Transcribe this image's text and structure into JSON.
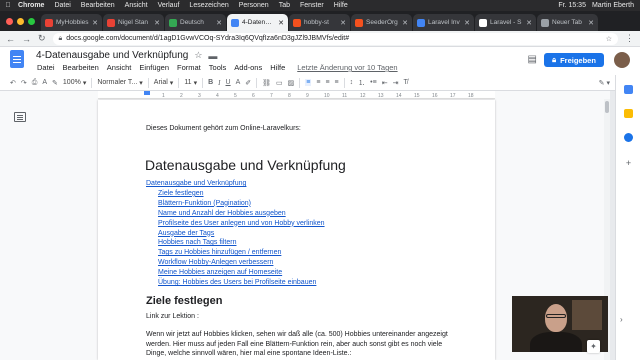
{
  "mac_menu": {
    "app": "Chrome",
    "items": [
      "Datei",
      "Bearbeiten",
      "Ansicht",
      "Verlauf",
      "Lesezeichen",
      "Personen",
      "Tab",
      "Fenster",
      "Hilfe"
    ],
    "right": [
      "Fr. 15:35",
      "Martin Eberth"
    ]
  },
  "tabs": [
    {
      "label": "MyHobbies",
      "color": "#e94235"
    },
    {
      "label": "Nigel Stan",
      "color": "#e94235"
    },
    {
      "label": "Deutsch",
      "color": "#34a853"
    },
    {
      "label": "4-Datenaus",
      "color": "#4285f4"
    },
    {
      "label": "hobby-st",
      "color": "#f4511e"
    },
    {
      "label": "SeederOrg",
      "color": "#f4511e"
    },
    {
      "label": "Laravel Inv",
      "color": "#4285f4"
    },
    {
      "label": "Laravel - S",
      "color": "#ffffff"
    },
    {
      "label": "Neuer Tab",
      "color": "#9aa0a6"
    }
  ],
  "address": {
    "url": "docs.google.com/document/d/1agD1GvwVCOq-SYdra3Iq6QVqfIza6nD3gJZl9JBMVfs/edit#"
  },
  "doc": {
    "title": "4-Datenausgabe und Verknüpfung",
    "menu": [
      "Datei",
      "Bearbeiten",
      "Ansicht",
      "Einfügen",
      "Format",
      "Tools",
      "Add-ons",
      "Hilfe"
    ],
    "last_edit": "Letzte Änderung vor 10 Tagen",
    "share_label": "Freigeben"
  },
  "toolbar": {
    "zoom": "100%",
    "style": "Normaler T...",
    "font": "Arial",
    "size": "11"
  },
  "ruler": [
    "1",
    "2",
    "3",
    "4",
    "5",
    "6",
    "7",
    "8",
    "9",
    "10",
    "11",
    "12",
    "13",
    "14",
    "15",
    "16",
    "17",
    "18"
  ],
  "content": {
    "intro": "Dieses Dokument gehört zum Online-Laravelkurs:",
    "heading": "Datenausgabe und Verknüpfung",
    "toc": [
      "Datenausgabe und Verknüpfung",
      "Ziele festlegen",
      "Blättern-Funktion (Pagination)",
      "Name und Anzahl der Hobbies ausgeben",
      "Profilseite des User anlegen und von Hobby verlinken",
      "Ausgabe der Tags",
      "Hobbies nach Tags filtern",
      "Tags zu Hobbies hinzufügen / entfernen",
      "Workflow Hobby-Anlegen verbessern",
      "Meine Hobbies anzeigen auf Homeseite",
      "Übung: Hobbies des Users bei Profilseite einbauen"
    ],
    "section_heading": "Ziele festlegen",
    "link_text": "Link zur Lektion :",
    "paragraph": "Wenn wir jetzt auf Hobbies klicken, sehen wir daß alle (ca. 500) Hobbies untereinander angezeigt werden. Hier muss auf jeden Fall eine Blättern-Funktion rein, aber auch sonst gibt es noch viele Dinge, welche sinnvoll wären, hier mal eine spontane Ideen-Liste.:"
  }
}
